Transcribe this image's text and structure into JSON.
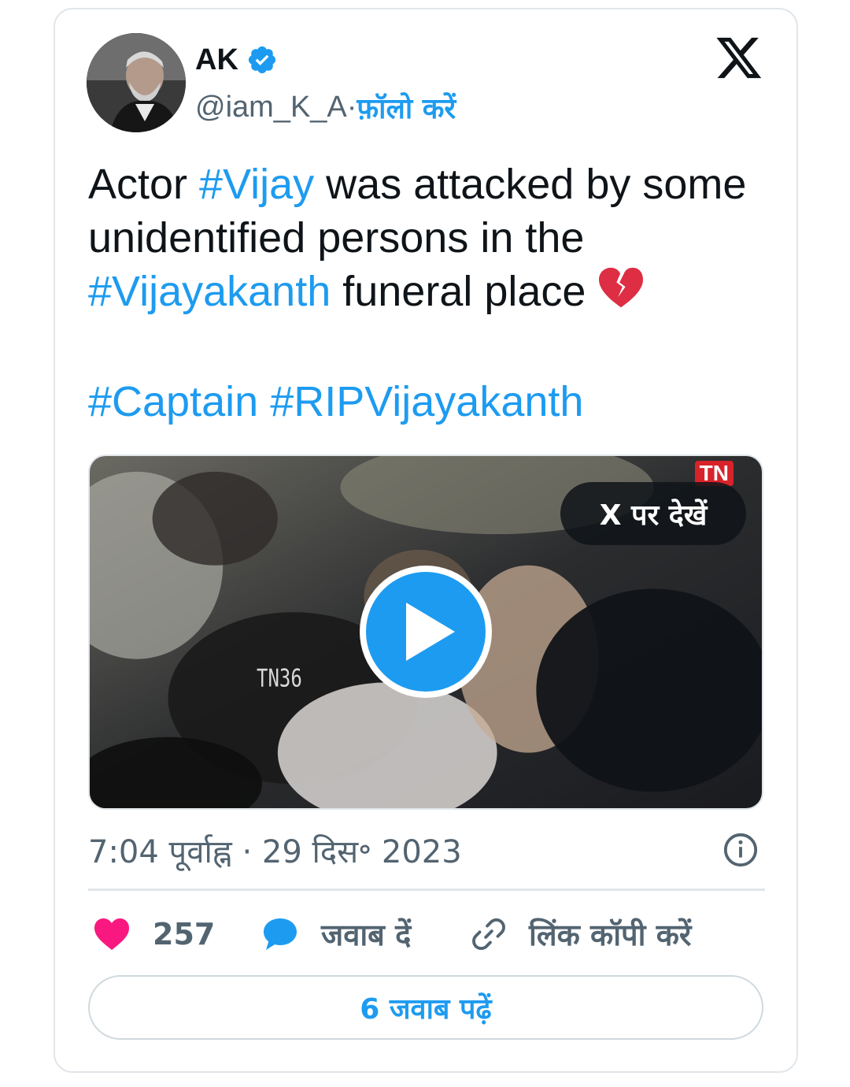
{
  "author": {
    "display_name": "AK",
    "handle": "@iam_K_A",
    "separator": " · ",
    "follow_label": "फ़ॉलो करें"
  },
  "tweet": {
    "text_1": "Actor ",
    "tag_1": "#Vijay",
    "text_2": " was attacked by some unidentified persons in the ",
    "tag_2": "#Vijayakanth",
    "text_3": " funeral place ",
    "tag_3": "#Captain",
    "tag_4": "#RIPVijayakanth",
    "emoji": "broken-heart"
  },
  "media": {
    "watch_label": "X पर देखें",
    "overlay_text_1": "TN",
    "overlay_text_2": "TN36"
  },
  "meta": {
    "timestamp": "7:04 पूर्वाह्न · 29 दिस॰ 2023"
  },
  "actions": {
    "likes": "257",
    "reply_label": "जवाब दें",
    "copy_link_label": "लिंक कॉपी करें",
    "read_replies_label": "6 जवाब पढ़ें"
  },
  "colors": {
    "accent": "#1d9bf0",
    "like": "#f91880",
    "text": "#0f1419",
    "secondary": "#536471"
  }
}
